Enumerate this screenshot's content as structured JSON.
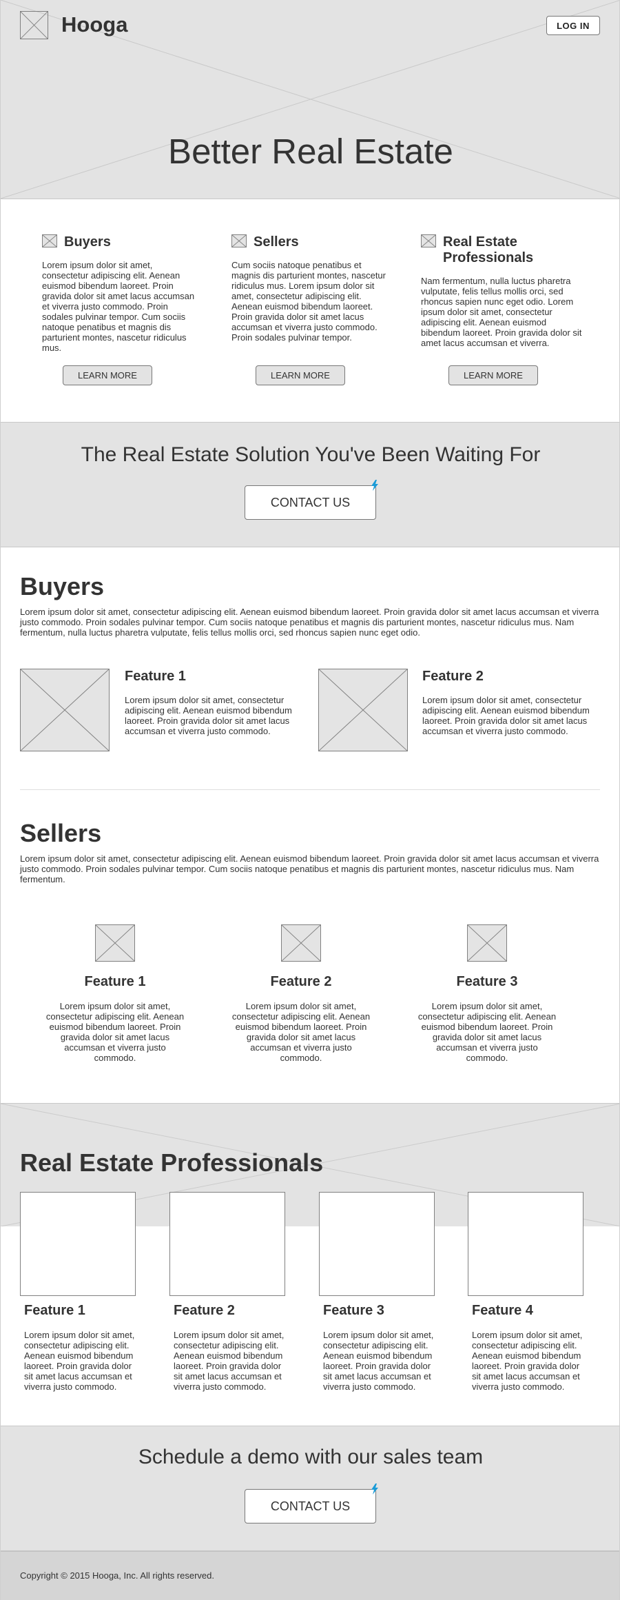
{
  "header": {
    "brand": "Hooga",
    "login_label": "LOG IN",
    "hero_title": "Better Real Estate"
  },
  "columns": [
    {
      "title": "Buyers",
      "text": "Lorem ipsum dolor sit amet, consectetur adipiscing elit. Aenean euismod bibendum laoreet. Proin gravida dolor sit amet lacus accumsan et viverra justo commodo. Proin sodales pulvinar tempor. Cum sociis natoque penatibus et magnis dis parturient montes, nascetur ridiculus mus.",
      "button": "LEARN MORE"
    },
    {
      "title": "Sellers",
      "text": "Cum sociis natoque penatibus et magnis dis parturient montes, nascetur ridiculus mus. Lorem ipsum dolor sit amet, consectetur adipiscing elit. Aenean euismod bibendum laoreet. Proin gravida dolor sit amet lacus accumsan et viverra justo commodo. Proin sodales pulvinar tempor.",
      "button": "LEARN MORE"
    },
    {
      "title": "Real Estate Professionals",
      "text": "Nam fermentum, nulla luctus pharetra vulputate, felis tellus mollis orci, sed rhoncus sapien nunc eget odio. Lorem ipsum dolor sit amet, consectetur adipiscing elit. Aenean euismod bibendum laoreet. Proin gravida dolor sit amet lacus accumsan et viverra.",
      "button": "LEARN MORE"
    }
  ],
  "cta1": {
    "title": "The Real Estate Solution You've Been Waiting For",
    "button": "CONTACT US"
  },
  "buyers": {
    "title": "Buyers",
    "text": "Lorem ipsum dolor sit amet, consectetur adipiscing elit. Aenean euismod bibendum laoreet. Proin gravida dolor sit amet lacus accumsan et viverra justo commodo. Proin sodales pulvinar tempor. Cum sociis natoque penatibus et magnis dis parturient montes, nascetur ridiculus mus. Nam fermentum, nulla luctus pharetra vulputate, felis tellus mollis orci, sed rhoncus sapien nunc eget odio.",
    "features": [
      {
        "title": "Feature 1",
        "text": "Lorem ipsum dolor sit amet, consectetur adipiscing elit. Aenean euismod bibendum laoreet. Proin gravida dolor sit amet lacus accumsan et viverra justo commodo."
      },
      {
        "title": "Feature 2",
        "text": "Lorem ipsum dolor sit amet, consectetur adipiscing elit. Aenean euismod bibendum laoreet. Proin gravida dolor sit amet lacus accumsan et viverra justo commodo."
      }
    ]
  },
  "sellers": {
    "title": "Sellers",
    "text": "Lorem ipsum dolor sit amet, consectetur adipiscing elit. Aenean euismod bibendum laoreet. Proin gravida dolor sit amet lacus accumsan et viverra justo commodo. Proin sodales pulvinar tempor. Cum sociis natoque penatibus et magnis dis parturient montes, nascetur ridiculus mus. Nam fermentum.",
    "features": [
      {
        "title": "Feature 1",
        "text": "Lorem ipsum dolor sit amet, consectetur adipiscing elit. Aenean euismod bibendum laoreet. Proin gravida dolor sit amet lacus accumsan et viverra justo commodo."
      },
      {
        "title": "Feature 2",
        "text": "Lorem ipsum dolor sit amet, consectetur adipiscing elit. Aenean euismod bibendum laoreet. Proin gravida dolor sit amet lacus accumsan et viverra justo commodo."
      },
      {
        "title": "Feature 3",
        "text": "Lorem ipsum dolor sit amet, consectetur adipiscing elit. Aenean euismod bibendum laoreet. Proin gravida dolor sit amet lacus accumsan et viverra justo commodo."
      }
    ]
  },
  "professionals": {
    "title": "Real Estate Professionals",
    "features": [
      {
        "title": "Feature 1",
        "text": "Lorem ipsum dolor sit amet, consectetur adipiscing elit. Aenean euismod bibendum laoreet. Proin gravida dolor sit amet lacus accumsan et viverra justo commodo."
      },
      {
        "title": "Feature 2",
        "text": "Lorem ipsum dolor sit amet, consectetur adipiscing elit. Aenean euismod bibendum laoreet. Proin gravida dolor sit amet lacus accumsan et viverra justo commodo."
      },
      {
        "title": "Feature 3",
        "text": "Lorem ipsum dolor sit amet, consectetur adipiscing elit. Aenean euismod bibendum laoreet. Proin gravida dolor sit amet lacus accumsan et viverra justo commodo."
      },
      {
        "title": "Feature 4",
        "text": "Lorem ipsum dolor sit amet, consectetur adipiscing elit. Aenean euismod bibendum laoreet. Proin gravida dolor sit amet lacus accumsan et viverra justo commodo."
      }
    ]
  },
  "cta2": {
    "title": "Schedule a demo with our sales team",
    "button": "CONTACT US"
  },
  "footer": {
    "copyright": "Copyright © 2015 Hooga, Inc. All rights reserved."
  },
  "colors": {
    "band": "#e3e3e3",
    "footer": "#d5d5d5",
    "text": "#333333",
    "hotspot": "#1a9bd7"
  }
}
